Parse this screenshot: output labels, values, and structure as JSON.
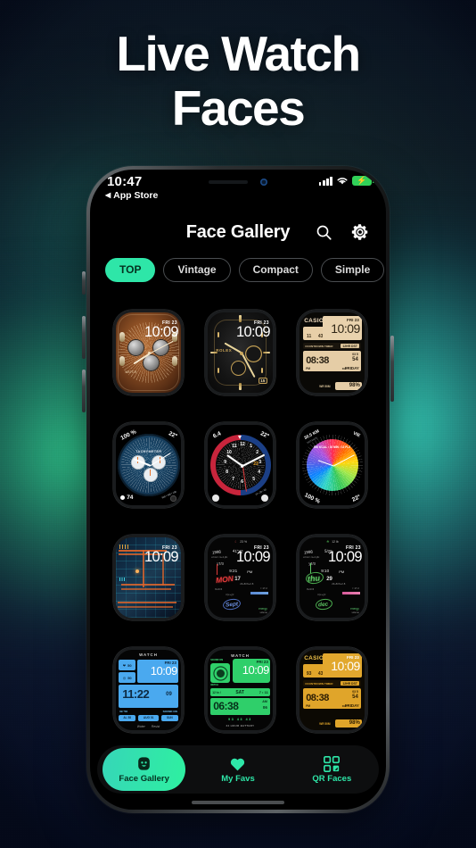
{
  "hero": {
    "line1": "Live Watch",
    "line2": "Faces"
  },
  "theme": {
    "accent": "#2ee6a8",
    "bg_green": "#2fc48a",
    "bg_teal": "#35c9b4",
    "bg_navy": "#0c1430",
    "screen_bg": "#000000"
  },
  "statusbar": {
    "time": "10:47",
    "back_label": "App Store",
    "back_icon": "triangle-left-icon",
    "signal_icon": "cellular-bars-icon",
    "wifi_icon": "wifi-icon",
    "battery_icon": "battery-charging-icon",
    "battery_bolt": "⚡"
  },
  "header": {
    "title": "Face Gallery",
    "search_icon": "search-icon",
    "settings_icon": "gear-icon"
  },
  "chips": [
    {
      "label": "TOP",
      "active": true
    },
    {
      "label": "Vintage",
      "active": false
    },
    {
      "label": "Compact",
      "active": false
    },
    {
      "label": "Simple",
      "active": false
    },
    {
      "label": "",
      "active": false
    }
  ],
  "faces": [
    {
      "id": "bronze-chrono",
      "style": "analog-bronze",
      "date": "FRI 23",
      "time": "10:09",
      "sub_label": "WATCH"
    },
    {
      "id": "rolex-gold",
      "style": "analog-gold",
      "date": "FRI 23",
      "time": "10:09",
      "brand": "ROLEX",
      "date_window": "15"
    },
    {
      "id": "casio-cream",
      "style": "digital-casio",
      "brand": "CASIO",
      "date": "FRI 23",
      "time": "10:09",
      "timer_label": "COUNTDOWN TIMER",
      "mode_label": "12HR DST",
      "timer_value": "08:38",
      "stop_value": "54",
      "sub_small": "03 5",
      "am_pm": "PM",
      "day_label": "DAY",
      "day_value": "FRIDAY",
      "wr_label": "WR 50M",
      "battery": "98%",
      "dual_left": "11",
      "dual_right": "43"
    },
    {
      "id": "blue-tachymeter",
      "style": "analog-blue-tachy",
      "top_left": "100 %",
      "top_right": "22°",
      "scale_label": "TACHYMETER",
      "bottom_left": "74",
      "bottom_right": "500 • 300 • 100"
    },
    {
      "id": "pepsi-gmt",
      "style": "analog-pepsi-gmt",
      "top_left": "6.4",
      "top_right": "22°",
      "date_window": "23",
      "bottom_right": "12 • 20 • 30"
    },
    {
      "id": "color-wheel",
      "style": "color-wheel",
      "top_left": "30.5 KM",
      "top_left_sub": "DISTANCE",
      "top_right": "VIE",
      "ring_label": "500 KCAL • 30 MIN • 12 FLZ",
      "bottom_left": "100 %",
      "bottom_right": "22°"
    },
    {
      "id": "circuit-board",
      "style": "circuit",
      "date": "FRI 23",
      "time": "10:09"
    },
    {
      "id": "chalkboard-mon",
      "style": "chalk-red",
      "date": "FRI 23",
      "time": "10:09",
      "day": "MON",
      "day_num": "17",
      "month": "Sept",
      "scribble_1": "1998",
      "scribble_2": "41°42",
      "scribble_3": "17/3",
      "scribble_4": "9:21",
      "scribble_5": "PM",
      "complication": "23 %"
    },
    {
      "id": "chalkboard-thu",
      "style": "chalk-green",
      "date": "FRI 23",
      "time": "10:09",
      "day": "thu",
      "day_num": "29",
      "month": "dec",
      "scribble_1": "1998",
      "scribble_2": "5/25",
      "scribble_3": "17/3",
      "scribble_4": "9:10",
      "scribble_5": "PM",
      "complication": "12 lb"
    },
    {
      "id": "lcd-blue",
      "style": "lcd-blue",
      "brand": "WATCH",
      "date": "FRI 23",
      "time": "10:09",
      "big_time": "11:22",
      "big_secs": "09",
      "row_a": "69 °58",
      "row_b": "0 91",
      "sound": "SOUND ON",
      "alarm": "ALARM ON",
      "foot_left": "Water",
      "foot_right": "Resist",
      "tag_1": "AL 58",
      "tag_2": "AUG 01",
      "tag_3": "SUN"
    },
    {
      "id": "lcd-green",
      "style": "lcd-green",
      "brand": "WATCH",
      "date": "FRI 23",
      "time": "10:09",
      "sound_label": "SOUND ON",
      "mode_label": "12 hr /",
      "day": "SAT",
      "day_num": "7 • 11",
      "big_time": "06:38",
      "am_pm": "AM",
      "secs": "06",
      "row": "93    43    43",
      "footer": "24 HOUR BATTERY",
      "side_label": "WATCH"
    },
    {
      "id": "casio-amber",
      "style": "digital-casio-amber",
      "brand": "CASIO",
      "date": "FRI 23",
      "time": "10:09",
      "timer_label": "COUNTDOWN TIMER",
      "mode_label": "12HR DST",
      "timer_value": "08:38",
      "stop_value": "54",
      "sub_small": "03 5",
      "am_pm": "PM",
      "day_label": "DAY",
      "day_value": "FRIDAY",
      "wr_label": "WR 50M",
      "battery": "98%",
      "dual_left": "93",
      "dual_right": "43"
    }
  ],
  "tabbar": [
    {
      "label": "Face Gallery",
      "icon": "watch-face-icon",
      "active": true
    },
    {
      "label": "My Favs",
      "icon": "heart-icon",
      "active": false
    },
    {
      "label": "QR Faces",
      "icon": "qr-code-icon",
      "active": false
    }
  ]
}
